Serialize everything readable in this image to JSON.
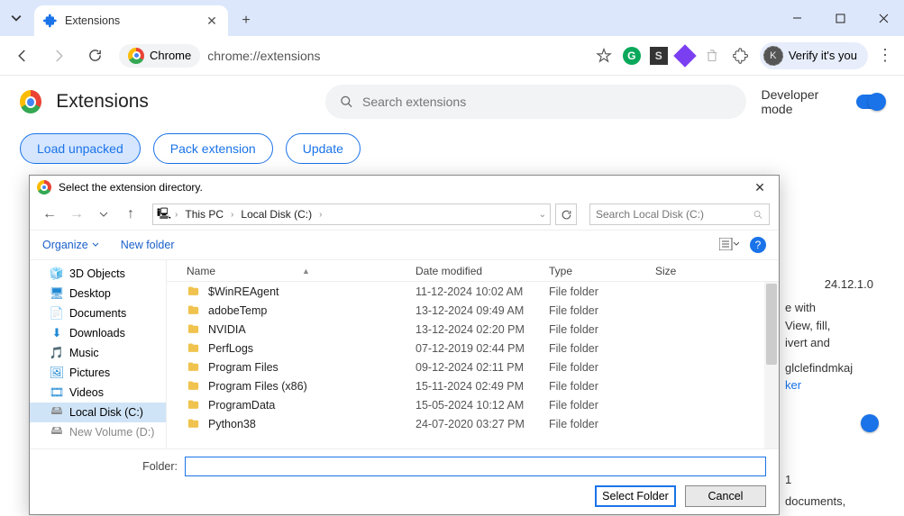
{
  "tab": {
    "title": "Extensions"
  },
  "url": "chrome://extensions",
  "omnibox_chip": "Chrome",
  "verify_label": "Verify it's you",
  "avatar_letter": "K",
  "page": {
    "title": "Extensions",
    "search_placeholder": "Search extensions",
    "dev_mode_label": "Developer mode",
    "btn_load": "Load unpacked",
    "btn_pack": "Pack extension",
    "btn_update": "Update"
  },
  "card": {
    "version": "24.12.1.0",
    "line1": "e with",
    "line2": "View, fill,",
    "line3": "ivert and",
    "id_frag": "glclefindmkaj",
    "link": "ker",
    "card2_ver": "1",
    "card2_line": "documents,"
  },
  "dialog": {
    "title": "Select the extension directory.",
    "breadcrumb": [
      "This PC",
      "Local Disk (C:)"
    ],
    "search_placeholder": "Search Local Disk (C:)",
    "organize": "Organize",
    "new_folder": "New folder",
    "columns": {
      "name": "Name",
      "date": "Date modified",
      "type": "Type",
      "size": "Size"
    },
    "sidebar": [
      {
        "label": "3D Objects",
        "icon": "cube",
        "color": "c-blue"
      },
      {
        "label": "Desktop",
        "icon": "desktop",
        "color": "c-blue"
      },
      {
        "label": "Documents",
        "icon": "doc",
        "color": "c-blue"
      },
      {
        "label": "Downloads",
        "icon": "download",
        "color": "c-blue"
      },
      {
        "label": "Music",
        "icon": "music",
        "color": "c-blue"
      },
      {
        "label": "Pictures",
        "icon": "picture",
        "color": "c-blue"
      },
      {
        "label": "Videos",
        "icon": "video",
        "color": "c-blue"
      },
      {
        "label": "Local Disk (C:)",
        "icon": "drive",
        "color": "c-drive",
        "selected": true
      },
      {
        "label": "New Volume (D:)",
        "icon": "drive",
        "color": "c-drive",
        "cut": true
      }
    ],
    "files": [
      {
        "name": "$WinREAgent",
        "date": "11-12-2024 10:02 AM",
        "type": "File folder"
      },
      {
        "name": "adobeTemp",
        "date": "13-12-2024 09:49 AM",
        "type": "File folder"
      },
      {
        "name": "NVIDIA",
        "date": "13-12-2024 02:20 PM",
        "type": "File folder"
      },
      {
        "name": "PerfLogs",
        "date": "07-12-2019 02:44 PM",
        "type": "File folder"
      },
      {
        "name": "Program Files",
        "date": "09-12-2024 02:11 PM",
        "type": "File folder"
      },
      {
        "name": "Program Files (x86)",
        "date": "15-11-2024 02:49 PM",
        "type": "File folder"
      },
      {
        "name": "ProgramData",
        "date": "15-05-2024 10:12 AM",
        "type": "File folder"
      },
      {
        "name": "Python38",
        "date": "24-07-2020 03:27 PM",
        "type": "File folder"
      }
    ],
    "folder_label": "Folder:",
    "folder_value": "",
    "btn_select": "Select Folder",
    "btn_cancel": "Cancel"
  }
}
